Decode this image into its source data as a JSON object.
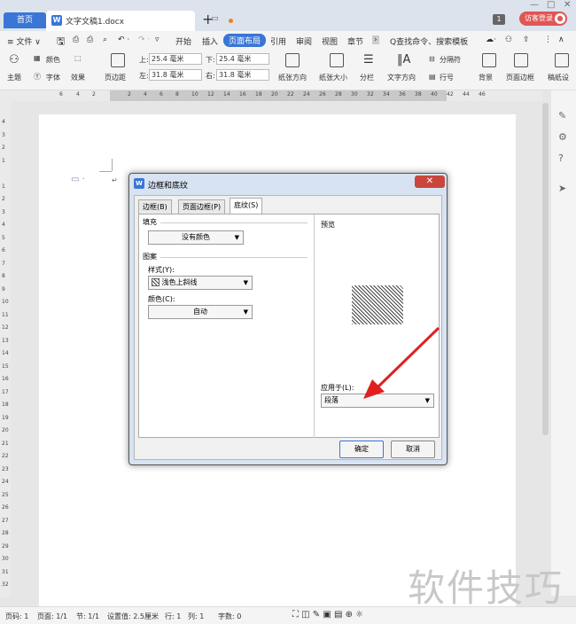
{
  "tabs": {
    "home": "首页",
    "doc_name": "文字文稿1.docx",
    "new_tab": "+",
    "badge": "1",
    "guest": "访客登录"
  },
  "menu": {
    "file": "≡ 文件 ∨",
    "items": [
      "开始",
      "插入",
      "页面布局",
      "引用",
      "审阅",
      "视图",
      "章节"
    ],
    "active_index": 2,
    "search": "Q查找命令、搜索模板"
  },
  "ribbon": {
    "theme": "主题",
    "colors": "颜色",
    "fonts": "字体",
    "effects": "效果",
    "margins": "页边距",
    "top_label": "上:",
    "top_val": "25.4 毫米",
    "bottom_label": "下:",
    "bottom_val": "25.4 毫米",
    "left_label": "左:",
    "left_val": "31.8 毫米",
    "right_label": "右:",
    "right_val": "31.8 毫米",
    "orientation": "纸张方向",
    "size": "纸张大小",
    "columns": "分栏",
    "text_dir": "文字方向",
    "line_no": "行号",
    "separator": "分隔符",
    "background": "背景",
    "page_border": "页面边框",
    "grid": "稿纸设"
  },
  "ruler_numbers": [
    "6",
    "4",
    "2",
    "2",
    "4",
    "6",
    "8",
    "10",
    "12",
    "14",
    "16",
    "18",
    "20",
    "22",
    "24",
    "26",
    "28",
    "30",
    "32",
    "34",
    "36",
    "38",
    "40",
    "42",
    "44",
    "46"
  ],
  "dialog": {
    "title": "边框和底纹",
    "tabs": [
      "边框(B)",
      "页面边框(P)",
      "底纹(S)"
    ],
    "selected_tab": 2,
    "fill_label": "填充",
    "fill_value": "没有颜色",
    "pattern_label": "图案",
    "style_label": "样式(Y):",
    "style_value": "浅色上斜线",
    "color_label": "颜色(C):",
    "color_value": "自动",
    "preview_label": "预览",
    "apply_label": "应用于(L):",
    "apply_value": "段落",
    "ok": "确定",
    "cancel": "取消"
  },
  "status": {
    "page_code": "页码: 1",
    "page": "页面: 1/1",
    "section": "节: 1/1",
    "setting": "设置值: 2.5厘米",
    "row": "行: 1",
    "col": "列: 1",
    "words": "字数: 0"
  },
  "watermark": "软件技巧",
  "colors": {
    "accent": "#3a76d6",
    "guest": "#e05555",
    "arrow": "#e02020"
  }
}
